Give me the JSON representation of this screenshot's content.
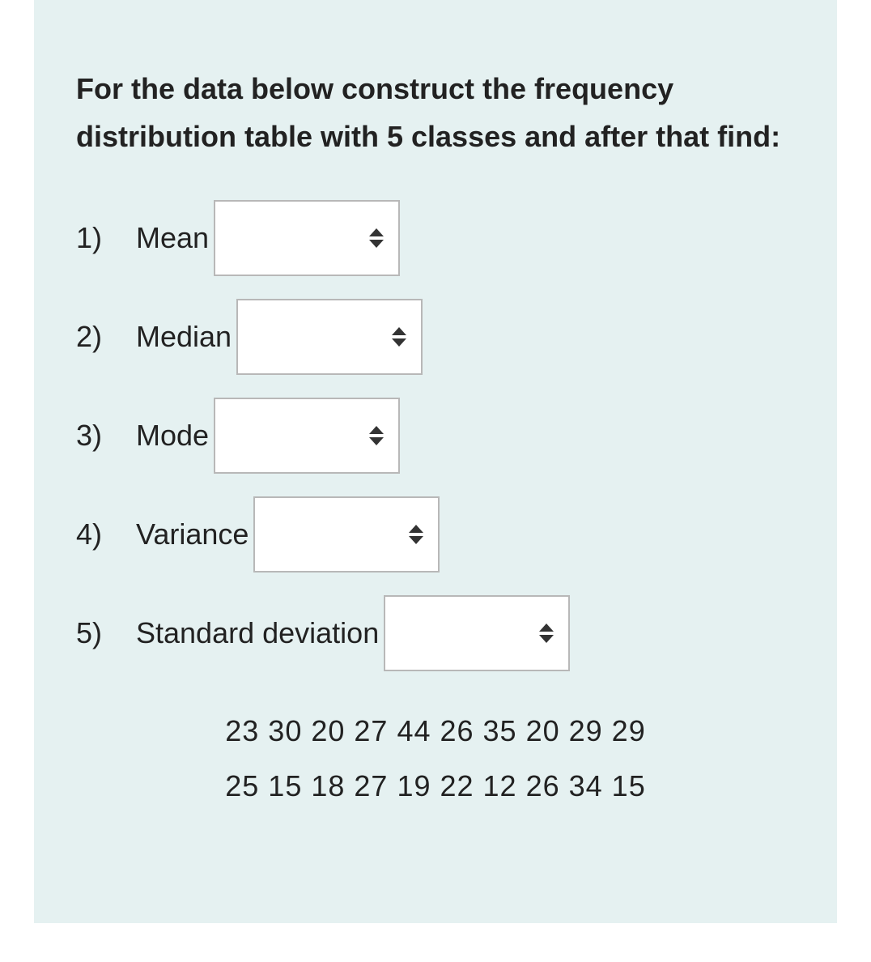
{
  "prompt": "For the data below construct  the frequency distribution table with 5 classes and after that find:",
  "items": [
    {
      "number": "1)",
      "label": "Mean"
    },
    {
      "number": "2)",
      "label": "Median"
    },
    {
      "number": "3)",
      "label": "Mode"
    },
    {
      "number": "4)",
      "label": "Variance"
    },
    {
      "number": "5)",
      "label": "Standard deviation"
    }
  ],
  "data_lines": [
    "23 30 20 27 44 26 35 20 29 29",
    "25  15  18  27  19  22  12  26 34  15"
  ]
}
